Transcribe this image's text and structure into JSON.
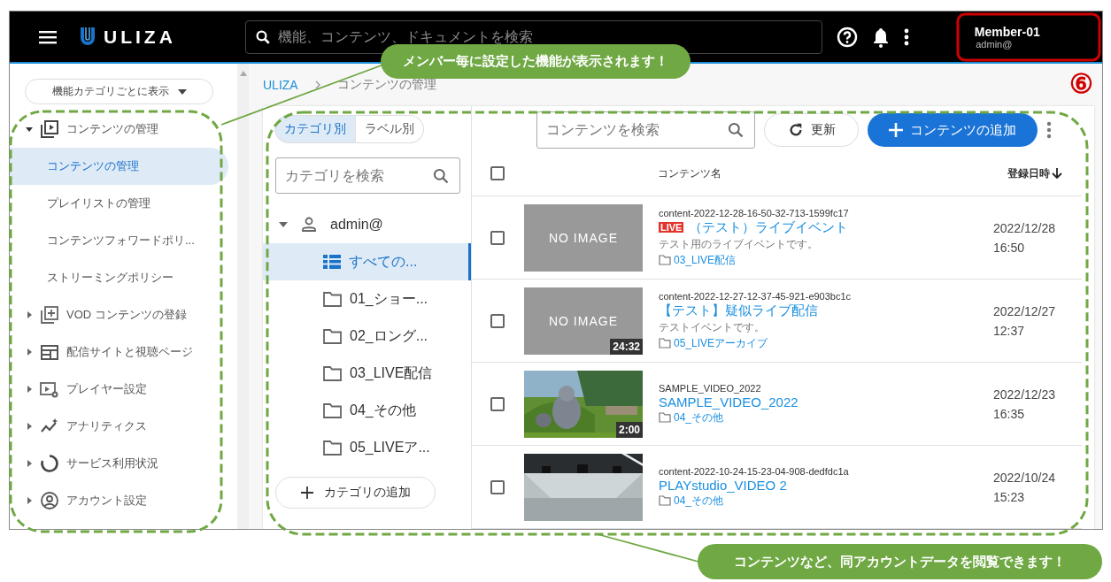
{
  "header": {
    "app_name": "ULIZA",
    "search": {
      "placeholder": "機能、コンテンツ、ドキュメントを検索"
    },
    "user": {
      "name": "Member-01",
      "account": "admin@"
    }
  },
  "sidebar": {
    "category_select": "機能カテゴリごとに表示",
    "items": [
      {
        "label": "コンテンツの管理",
        "expanded": true,
        "children": [
          {
            "label": "コンテンツの管理",
            "selected": true
          },
          {
            "label": "プレイリストの管理",
            "selected": false
          },
          {
            "label": "コンテンツフォワードポリ...",
            "selected": false
          },
          {
            "label": "ストリーミングポリシー",
            "selected": false
          }
        ]
      },
      {
        "label": "VOD コンテンツの登録",
        "expanded": false
      },
      {
        "label": "配信サイトと視聴ページ",
        "expanded": false
      },
      {
        "label": "プレイヤー設定",
        "expanded": false
      },
      {
        "label": "アナリティクス",
        "expanded": false
      },
      {
        "label": "サービス利用状況",
        "expanded": false
      },
      {
        "label": "アカウント設定",
        "expanded": false
      }
    ]
  },
  "breadcrumb": [
    {
      "label": "ULIZA",
      "kind": "link"
    },
    {
      "label": "コンテンツの管理",
      "kind": "current"
    }
  ],
  "category_panel": {
    "tabs": [
      {
        "label": "カテゴリ別",
        "selected": true
      },
      {
        "label": "ラベル別",
        "selected": false
      }
    ],
    "search": {
      "placeholder": "カテゴリを検索"
    },
    "tree": {
      "label": "admin@",
      "expanded": true,
      "children": [
        {
          "label": "すべての...",
          "kind": "all",
          "selected": true
        },
        {
          "label": "01_ショー...",
          "kind": "folder",
          "selected": false
        },
        {
          "label": "02_ロング...",
          "kind": "folder",
          "selected": false
        },
        {
          "label": "03_LIVE配信",
          "kind": "folder",
          "selected": false
        },
        {
          "label": "04_その他",
          "kind": "folder",
          "selected": false
        },
        {
          "label": "05_LIVEア...",
          "kind": "folder",
          "selected": false
        }
      ]
    },
    "add_button": "カテゴリの追加"
  },
  "content_panel": {
    "search": {
      "placeholder": "コンテンツを検索"
    },
    "refresh_button": "更新",
    "add_button": "コンテンツの追加",
    "table": {
      "select_all_checked": false,
      "columns": [
        "コンテンツ名",
        "登録日時"
      ],
      "rows": [
        {
          "checked": false,
          "kind": "no_image",
          "thumb_text": "NO IMAGE",
          "id": "content-2022-12-28-16-50-32-713-1599fc17",
          "live": true,
          "live_label": "LIVE",
          "title": "（テスト）ライブイベント",
          "description": "テスト用のライブイベントです。",
          "folder": "03_LIVE配信",
          "date": "2022/12/28",
          "time": "16:50"
        },
        {
          "checked": false,
          "kind": "no_image",
          "thumb_text": "NO IMAGE",
          "duration": "24:32",
          "id": "content-2022-12-27-12-37-45-921-e903bc1c",
          "live": false,
          "title": "【テスト】疑似ライブ配信",
          "description": "テストイベントです。",
          "folder": "05_LIVEアーカイブ",
          "date": "2022/12/27",
          "time": "12:37"
        },
        {
          "checked": false,
          "kind": "picture",
          "duration": "2:00",
          "id": "SAMPLE_VIDEO_2022",
          "live": false,
          "title": "SAMPLE_VIDEO_2022",
          "folder": "04_その他",
          "date": "2022/12/23",
          "time": "16:35"
        },
        {
          "checked": false,
          "kind": "picture",
          "id": "content-2022-10-24-15-23-04-908-dedfdc1a",
          "live": false,
          "title": "PLAYstudio_VIDEO 2",
          "folder": "04_その他",
          "date": "2022/10/24",
          "time": "15:23"
        }
      ]
    }
  },
  "annotations": {
    "top_callout": "メンバー毎に設定した機能が表示されます！",
    "bottom_callout": "コンテンツなど、同アカウントデータを閲覧できます！",
    "step_marker": "⑥"
  }
}
